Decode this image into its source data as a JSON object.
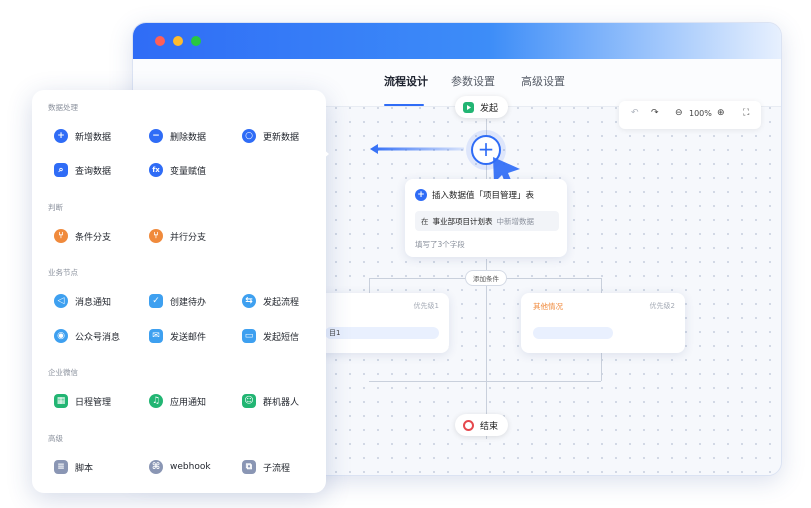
{
  "window": {
    "tabs": [
      "流程设计",
      "参数设置",
      "高级设置"
    ],
    "active_tab": "流程设计"
  },
  "toolbar": {
    "undo": "↶",
    "redo": "↷",
    "zoom_out": "⊖",
    "zoom": "100%",
    "zoom_in": "⊕",
    "fullscreen": "⛶"
  },
  "flow": {
    "start_label": "发起",
    "add_button": "+",
    "insert_node": {
      "title": "插入数据值「项目管理」表",
      "field_label": "在",
      "field_value": "事业部项目计划表",
      "field_suffix": "中新增数据",
      "footer": "填写了3个字段"
    },
    "add_condition": "添加条件",
    "branch_left": {
      "priority": "优先级1",
      "value": "目1"
    },
    "branch_right": {
      "title": "其他情况",
      "priority": "优先级2"
    },
    "end_label": "结束"
  },
  "panel": {
    "sections": [
      {
        "title": "数据处理",
        "items": [
          {
            "label": "新增数据",
            "icon": "plus-icon",
            "color": "#2f6cf6"
          },
          {
            "label": "删除数据",
            "icon": "minus-icon",
            "color": "#2f6cf6"
          },
          {
            "label": "更新数据",
            "icon": "refresh-icon",
            "color": "#2f6cf6"
          },
          {
            "label": "查询数据",
            "icon": "search-icon",
            "color": "#2f6cf6"
          },
          {
            "label": "变量赋值",
            "icon": "variable-icon",
            "color": "#2f6cf6"
          }
        ]
      },
      {
        "title": "判断",
        "items": [
          {
            "label": "条件分支",
            "icon": "branch-icon",
            "color": "#f08a3c"
          },
          {
            "label": "并行分支",
            "icon": "parallel-branch-icon",
            "color": "#f08a3c"
          }
        ]
      },
      {
        "title": "业务节点",
        "items": [
          {
            "label": "消息通知",
            "icon": "megaphone-icon",
            "color": "#3ea0f0"
          },
          {
            "label": "创建待办",
            "icon": "todo-icon",
            "color": "#3ea0f0"
          },
          {
            "label": "发起流程",
            "icon": "flow-icon",
            "color": "#3ea0f0"
          },
          {
            "label": "公众号消息",
            "icon": "official-account-icon",
            "color": "#3ea0f0"
          },
          {
            "label": "发送邮件",
            "icon": "mail-icon",
            "color": "#3ea0f0"
          },
          {
            "label": "发起短信",
            "icon": "sms-icon",
            "color": "#3ea0f0"
          }
        ]
      },
      {
        "title": "企业微信",
        "items": [
          {
            "label": "日程管理",
            "icon": "calendar-icon",
            "color": "#22b573"
          },
          {
            "label": "应用通知",
            "icon": "bell-icon",
            "color": "#22b573"
          },
          {
            "label": "群机器人",
            "icon": "robot-icon",
            "color": "#22b573"
          }
        ]
      },
      {
        "title": "高级",
        "items": [
          {
            "label": "脚本",
            "icon": "script-icon",
            "color": "#8a96b4"
          },
          {
            "label": "webhook",
            "icon": "webhook-icon",
            "color": "#8a96b4"
          },
          {
            "label": "子流程",
            "icon": "subflow-icon",
            "color": "#8a96b4"
          }
        ]
      }
    ]
  },
  "colors": {
    "accent": "#2f6cf6",
    "start": "#22b573",
    "end": "#e5484d",
    "other_case": "#f08a3c"
  }
}
